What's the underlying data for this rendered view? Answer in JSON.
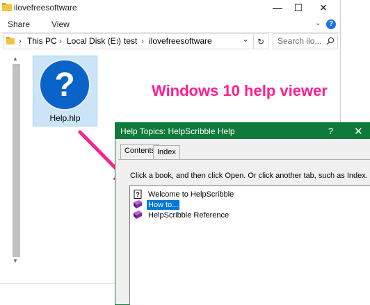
{
  "explorer": {
    "title": "ilovefreesoftware",
    "window_controls": {
      "minimize": "—",
      "maximize": "☐",
      "close": "✕"
    },
    "ribbon": {
      "tabs": [
        "Share",
        "View"
      ],
      "expand_icon": "chevron-down-icon",
      "help_icon": "?"
    },
    "address": {
      "separator": "›",
      "crumbs": [
        "This PC",
        "Local Disk (E:)",
        "test",
        "ilovefreesoftware"
      ],
      "dropdown": "⌄",
      "refresh": "↻"
    },
    "search": {
      "placeholder": "Search ilo..."
    },
    "file": {
      "name": "Help.hlp",
      "icon": "help-question-icon"
    }
  },
  "annotation": {
    "text": "Windows 10 help viewer",
    "color": "#ff1f8f"
  },
  "help_dialog": {
    "title": "Help Topics: HelpScribble Help",
    "help_button": "?",
    "close_button": "✕",
    "tabs": [
      "Contents",
      "Index"
    ],
    "active_tab": "Contents",
    "instruction": "Click a book, and then click Open. Or click another tab, such as Index.",
    "topics": [
      {
        "label": "Welcome to HelpScribble",
        "icon": "page-question-icon",
        "selected": false
      },
      {
        "label": "How to...",
        "icon": "book-icon",
        "selected": true
      },
      {
        "label": "HelpScribble Reference",
        "icon": "book-icon",
        "selected": false
      }
    ],
    "title_bar_color": "#0f7b3a"
  }
}
